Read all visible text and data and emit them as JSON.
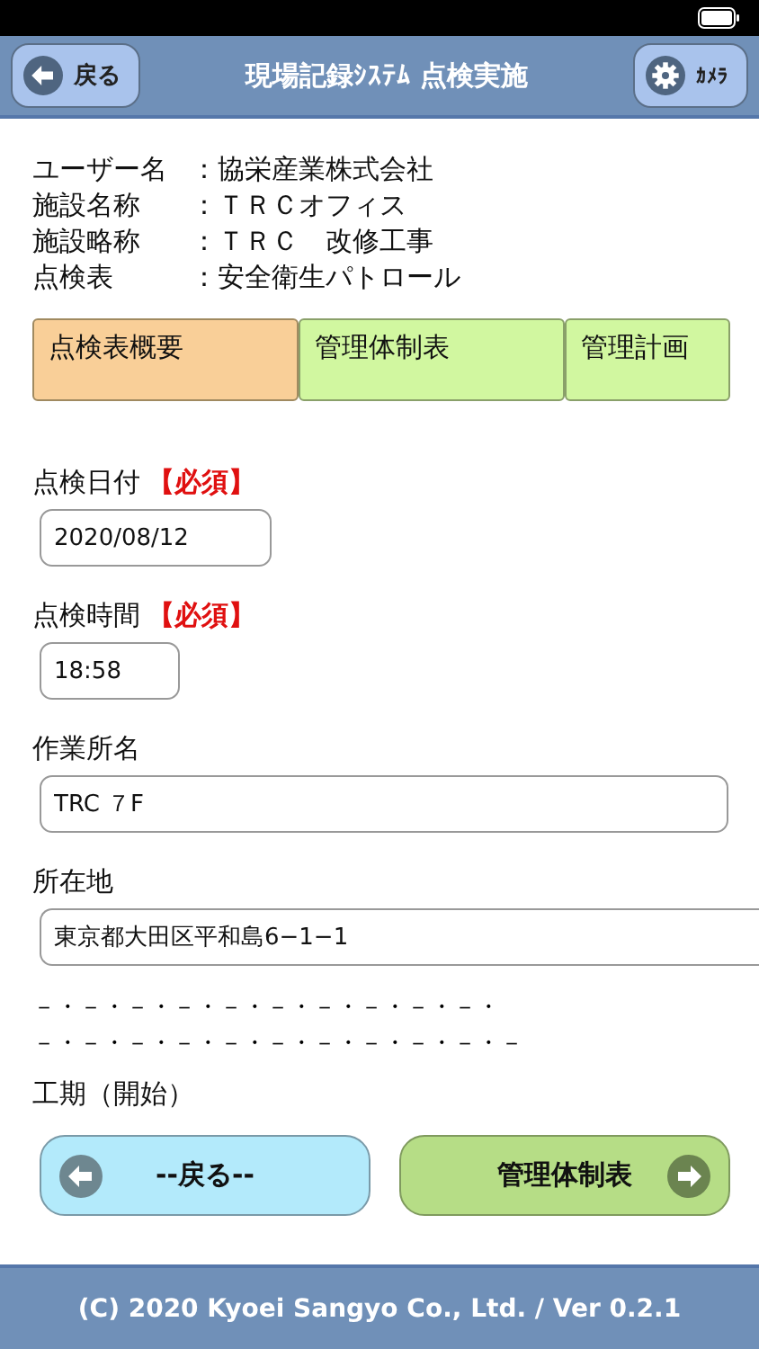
{
  "header": {
    "back_button": "戻る",
    "title": "現場記録ｼｽﾃﾑ 点検実施",
    "camera_button": "ｶﾒﾗ"
  },
  "info": [
    {
      "label": "ユーザー名",
      "value": "：協栄産業株式会社"
    },
    {
      "label": "施設名称",
      "value": "：ＴＲＣオフィス"
    },
    {
      "label": "施設略称",
      "value": "：ＴＲＣ　改修工事"
    },
    {
      "label": "点検表",
      "value": "：安全衛生パトロール"
    }
  ],
  "tabs": [
    {
      "label": "点検表概要",
      "selected": true
    },
    {
      "label": "管理体制表",
      "selected": false
    },
    {
      "label": "管理計画",
      "selected": false
    }
  ],
  "fields": [
    {
      "kind": "date",
      "label": "点検日付",
      "required_mark": "【必須】",
      "value": "2020/08/12"
    },
    {
      "kind": "time",
      "label": "点検時間",
      "required_mark": "【必須】",
      "value": "18:58"
    },
    {
      "kind": "text",
      "label": "作業所名",
      "value": "TRC ７F"
    },
    {
      "kind": "wide",
      "label": "所在地",
      "value": "東京都大田区平和島6−1−1"
    }
  ],
  "separators": [
    "－・－・－・－・－・－・－・－・－・－・",
    "－・－・－・－・－・－・－・－・－・－・－"
  ],
  "next_label": "工期（開始）",
  "nav": {
    "back": "--戻る--",
    "next": "管理体制表"
  },
  "footer": "(C) 2020 Kyoei Sangyo Co., Ltd. / Ver 0.2.1"
}
